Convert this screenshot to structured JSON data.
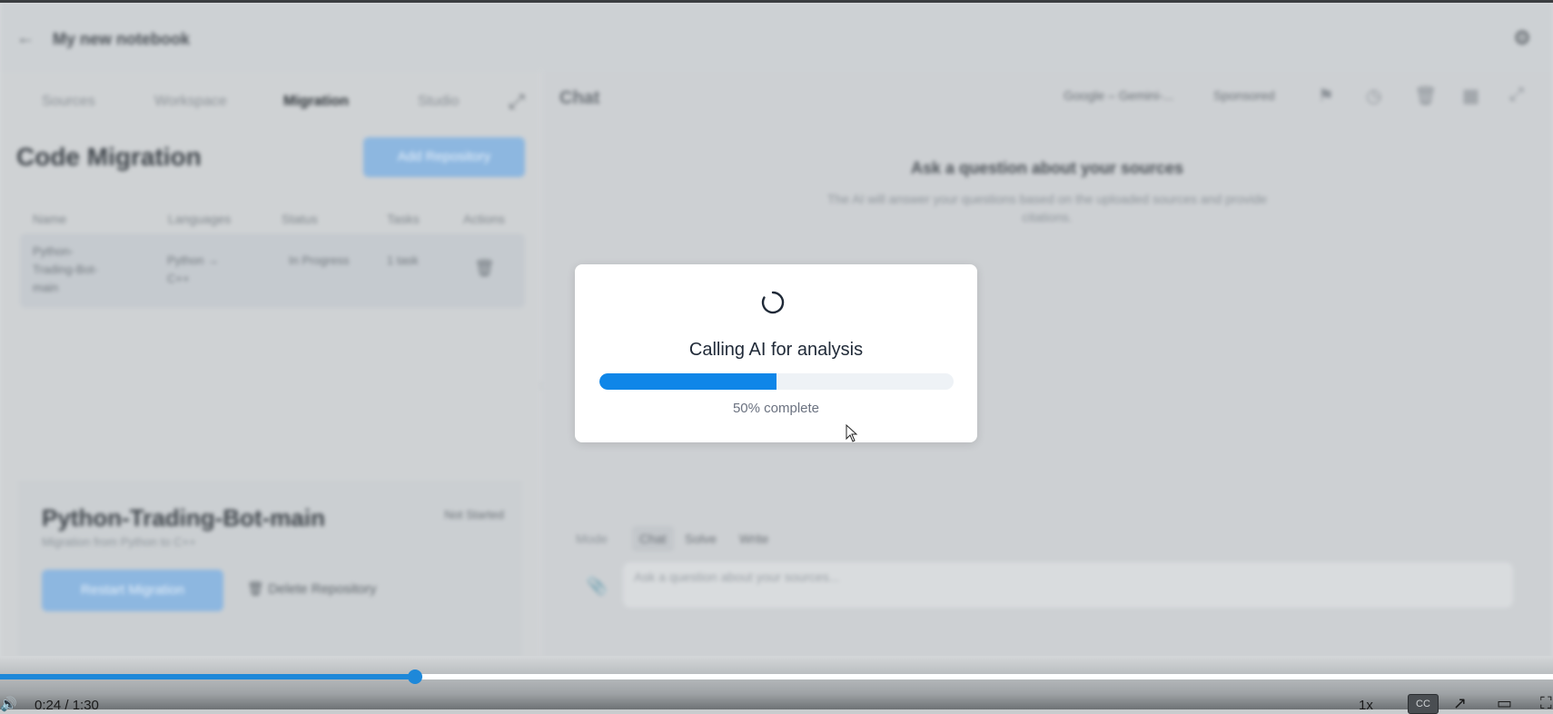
{
  "header": {
    "back_icon": "arrow-left-icon",
    "title": "My new notebook",
    "settings_icon": "gear-icon"
  },
  "left_panel": {
    "tabs": [
      {
        "label": "Sources"
      },
      {
        "label": "Workspace"
      },
      {
        "label": "Migration"
      },
      {
        "label": "Studio"
      }
    ],
    "active_tab": "Migration",
    "title": "Code Migration",
    "add_button": "Add Repository",
    "table": {
      "headers": [
        "Name",
        "Languages",
        "Status",
        "Tasks",
        "Actions"
      ],
      "rows": [
        {
          "name": "Python-Trading-Bot-main",
          "languages": "Python → C++",
          "status": "In Progress",
          "tasks": "1 task"
        }
      ]
    },
    "repo": {
      "title": "Python-Trading-Bot-main",
      "subtitle": "Migration from Python to C++",
      "status": "Not Started",
      "restart_button": "Restart Migration",
      "delete_button": "Delete Repository"
    }
  },
  "chat": {
    "title": "Chat",
    "model": "Google – Gemini-...",
    "selector": "Sponsored",
    "empty_title": "Ask a question about your sources",
    "empty_subtitle": "The AI will answer your questions based on the uploaded sources and provide citations.",
    "mode_label": "Mode",
    "modes": [
      "Chat",
      "Solve",
      "Write"
    ],
    "input_placeholder": "Ask a question about your sources..."
  },
  "modal": {
    "title": "Calling AI for analysis",
    "progress_fraction": 0.5,
    "progress_label": "50% complete"
  },
  "player": {
    "time": "0:24 / 1:30",
    "played_fraction": 0.267,
    "speed": "1x",
    "cc_label": "CC",
    "accent": "#1e88d9"
  }
}
